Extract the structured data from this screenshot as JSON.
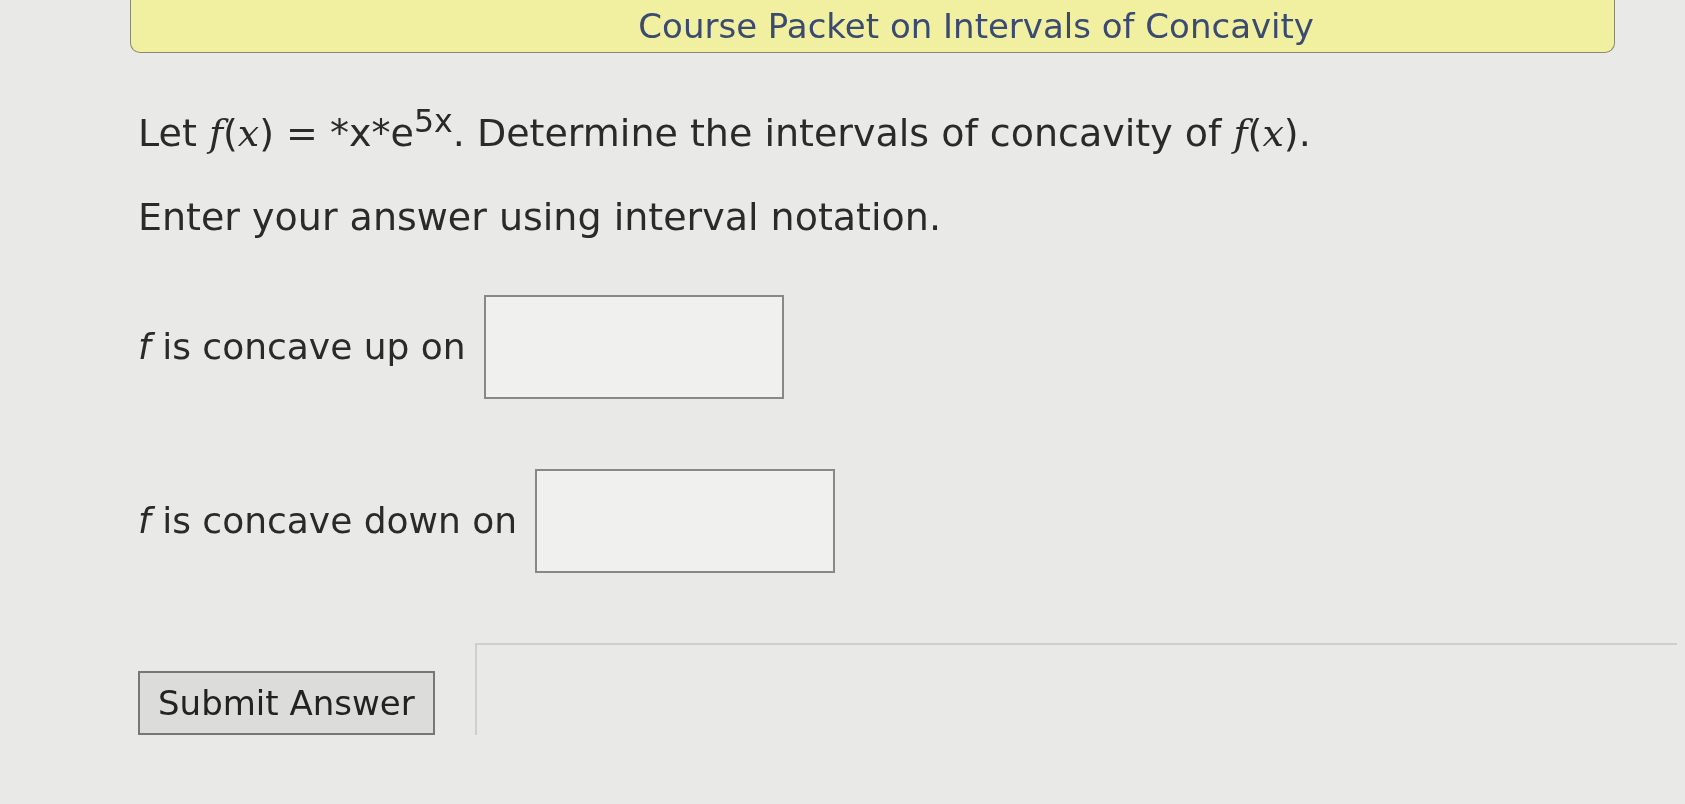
{
  "banner": {
    "title": "Course Packet on Intervals of Concavity"
  },
  "question": {
    "prompt": "Let *f*(*x*) = *x*e$^{5x}$. Determine the intervals of concavity of *f*(*x*).",
    "instruction": "Enter your answer using interval notation."
  },
  "answers": [
    {
      "label": "*f* is concave up on"
    },
    {
      "label": "*f* is concave down on"
    }
  ],
  "submit": {
    "label": "Submit Answer"
  }
}
